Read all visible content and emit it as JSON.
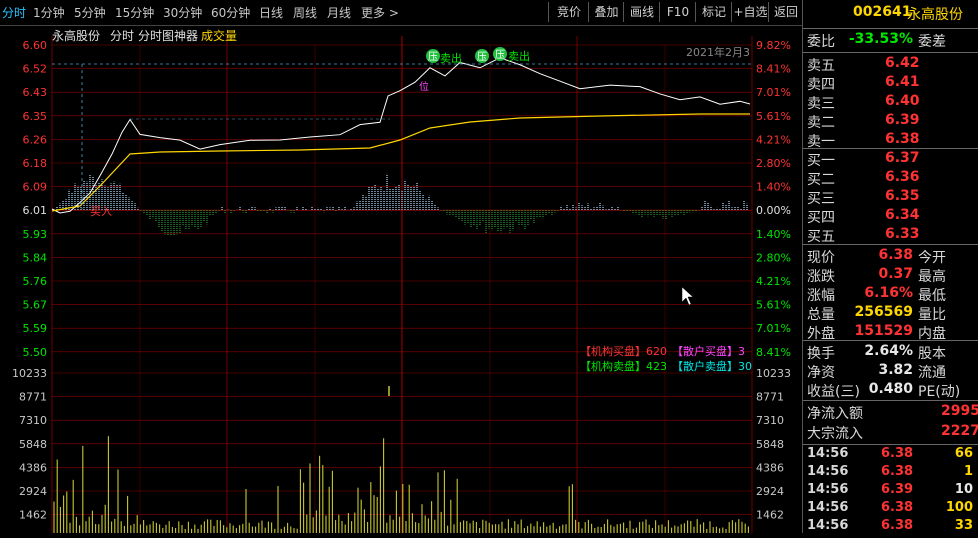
{
  "tabs": [
    "分时",
    "1分钟",
    "5分钟",
    "15分钟",
    "30分钟",
    "60分钟",
    "日线",
    "周线",
    "月线",
    "更多 >"
  ],
  "tools": [
    "竞价",
    "叠加",
    "画线",
    "F10",
    "标记",
    "+自选",
    "返回"
  ],
  "chart_header": {
    "name": "永高股份",
    "mode": "分时",
    "tool": "分时图神器",
    "indicator": "成交量",
    "date": "2021年2月3"
  },
  "price_ticks": [
    "6.60",
    "6.52",
    "6.43",
    "6.35",
    "6.26",
    "6.18",
    "6.09",
    "6.01",
    "5.93",
    "5.84",
    "5.76",
    "5.67",
    "5.59",
    "5.50"
  ],
  "pct_ticks": [
    "9.82%",
    "8.41%",
    "7.01%",
    "5.61%",
    "4.21%",
    "2.80%",
    "1.40%",
    "0.00%",
    "1.40%",
    "2.80%",
    "4.21%",
    "5.61%",
    "7.01%",
    "8.41%"
  ],
  "vol_ticks": [
    "10233",
    "8771",
    "7310",
    "5848",
    "4386",
    "2924",
    "1462"
  ],
  "markers": {
    "buy": "买入",
    "sell": "卖出",
    "low": "低",
    "sell_badge": "压",
    "pos": "位"
  },
  "legend": {
    "row1": [
      {
        "text": "【机构买盘】620",
        "color": "#ff3333"
      },
      {
        "text": "【散户买盘】3",
        "color": "#ff44ff"
      }
    ],
    "row2": [
      {
        "text": "【机构卖盘】423",
        "color": "#00e600"
      },
      {
        "text": "【散户卖盘】30",
        "color": "#00e6e6"
      }
    ]
  },
  "stock": {
    "code": "002641",
    "name": "永高股份"
  },
  "weibi": {
    "label": "委比",
    "value": "-33.53%",
    "label2": "委差"
  },
  "asks": [
    {
      "label": "卖五",
      "price": "6.42"
    },
    {
      "label": "卖四",
      "price": "6.41"
    },
    {
      "label": "卖三",
      "price": "6.40"
    },
    {
      "label": "卖二",
      "price": "6.39"
    },
    {
      "label": "卖一",
      "price": "6.38"
    }
  ],
  "bids": [
    {
      "label": "买一",
      "price": "6.37"
    },
    {
      "label": "买二",
      "price": "6.36"
    },
    {
      "label": "买三",
      "price": "6.35"
    },
    {
      "label": "买四",
      "price": "6.34"
    },
    {
      "label": "买五",
      "price": "6.33"
    }
  ],
  "quote": [
    {
      "label": "现价",
      "value": "6.38",
      "color": "red",
      "label2": "今开"
    },
    {
      "label": "涨跌",
      "value": "0.37",
      "color": "red",
      "label2": "最高"
    },
    {
      "label": "涨幅",
      "value": "6.16%",
      "color": "red",
      "label2": "最低"
    },
    {
      "label": "总量",
      "value": "256569",
      "color": "yellow",
      "label2": "量比"
    },
    {
      "label": "外盘",
      "value": "151529",
      "color": "red",
      "label2": "内盘"
    }
  ],
  "stats": [
    {
      "label": "换手",
      "value": "2.64%",
      "label2": "股本"
    },
    {
      "label": "净资",
      "value": "3.82",
      "label2": "流通"
    },
    {
      "label": "收益(三)",
      "value": "0.480",
      "label2": "PE(动)"
    }
  ],
  "flows": [
    {
      "label": "净流入额",
      "value": "2995"
    },
    {
      "label": "大宗流入",
      "value": "2227"
    }
  ],
  "trades": [
    {
      "time": "14:56",
      "price": "6.38",
      "vol": "66",
      "vcolor": "yellow"
    },
    {
      "time": "14:56",
      "price": "6.38",
      "vol": "1",
      "vcolor": "yellow"
    },
    {
      "time": "14:56",
      "price": "6.39",
      "vol": "10",
      "vcolor": "white"
    },
    {
      "time": "14:56",
      "price": "6.38",
      "vol": "100",
      "vcolor": "yellow"
    },
    {
      "time": "14:56",
      "price": "6.38",
      "vol": "33",
      "vcolor": "yellow"
    }
  ],
  "colors": {
    "price_line": "#ffffff",
    "avg_line": "#ffd700",
    "grid": "#8b0000",
    "up": "#ff3333",
    "down": "#00e600",
    "vol": "#c8c832"
  }
}
